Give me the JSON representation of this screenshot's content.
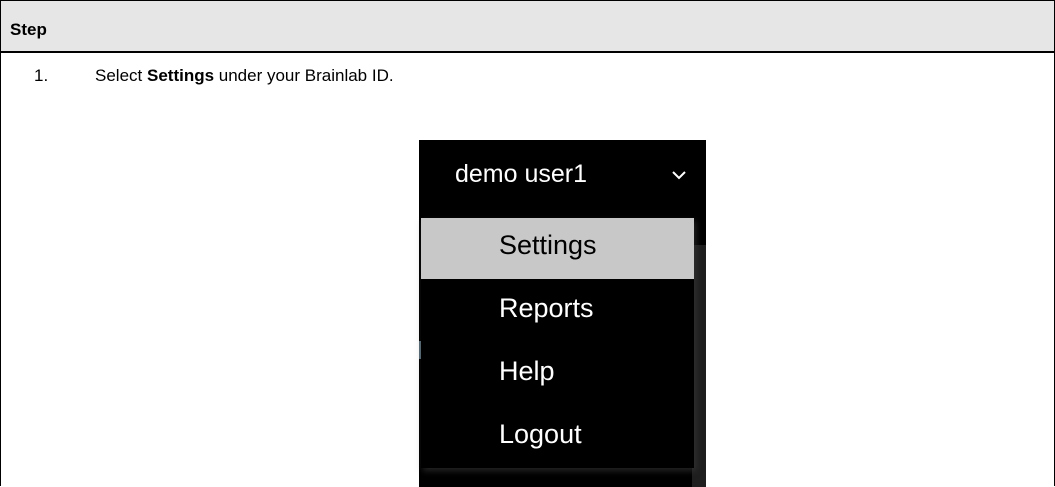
{
  "table": {
    "header": "Step"
  },
  "step": {
    "number": "1.",
    "text_before": "Select ",
    "text_bold": "Settings",
    "text_after": " under your Brainlab ID."
  },
  "dropdown": {
    "user_name": "demo user1",
    "chevron_icon": "chevron-down-icon",
    "items": [
      {
        "label": "Settings",
        "selected": true
      },
      {
        "label": "Reports",
        "selected": false
      },
      {
        "label": "Help",
        "selected": false
      },
      {
        "label": "Logout",
        "selected": false
      }
    ]
  }
}
